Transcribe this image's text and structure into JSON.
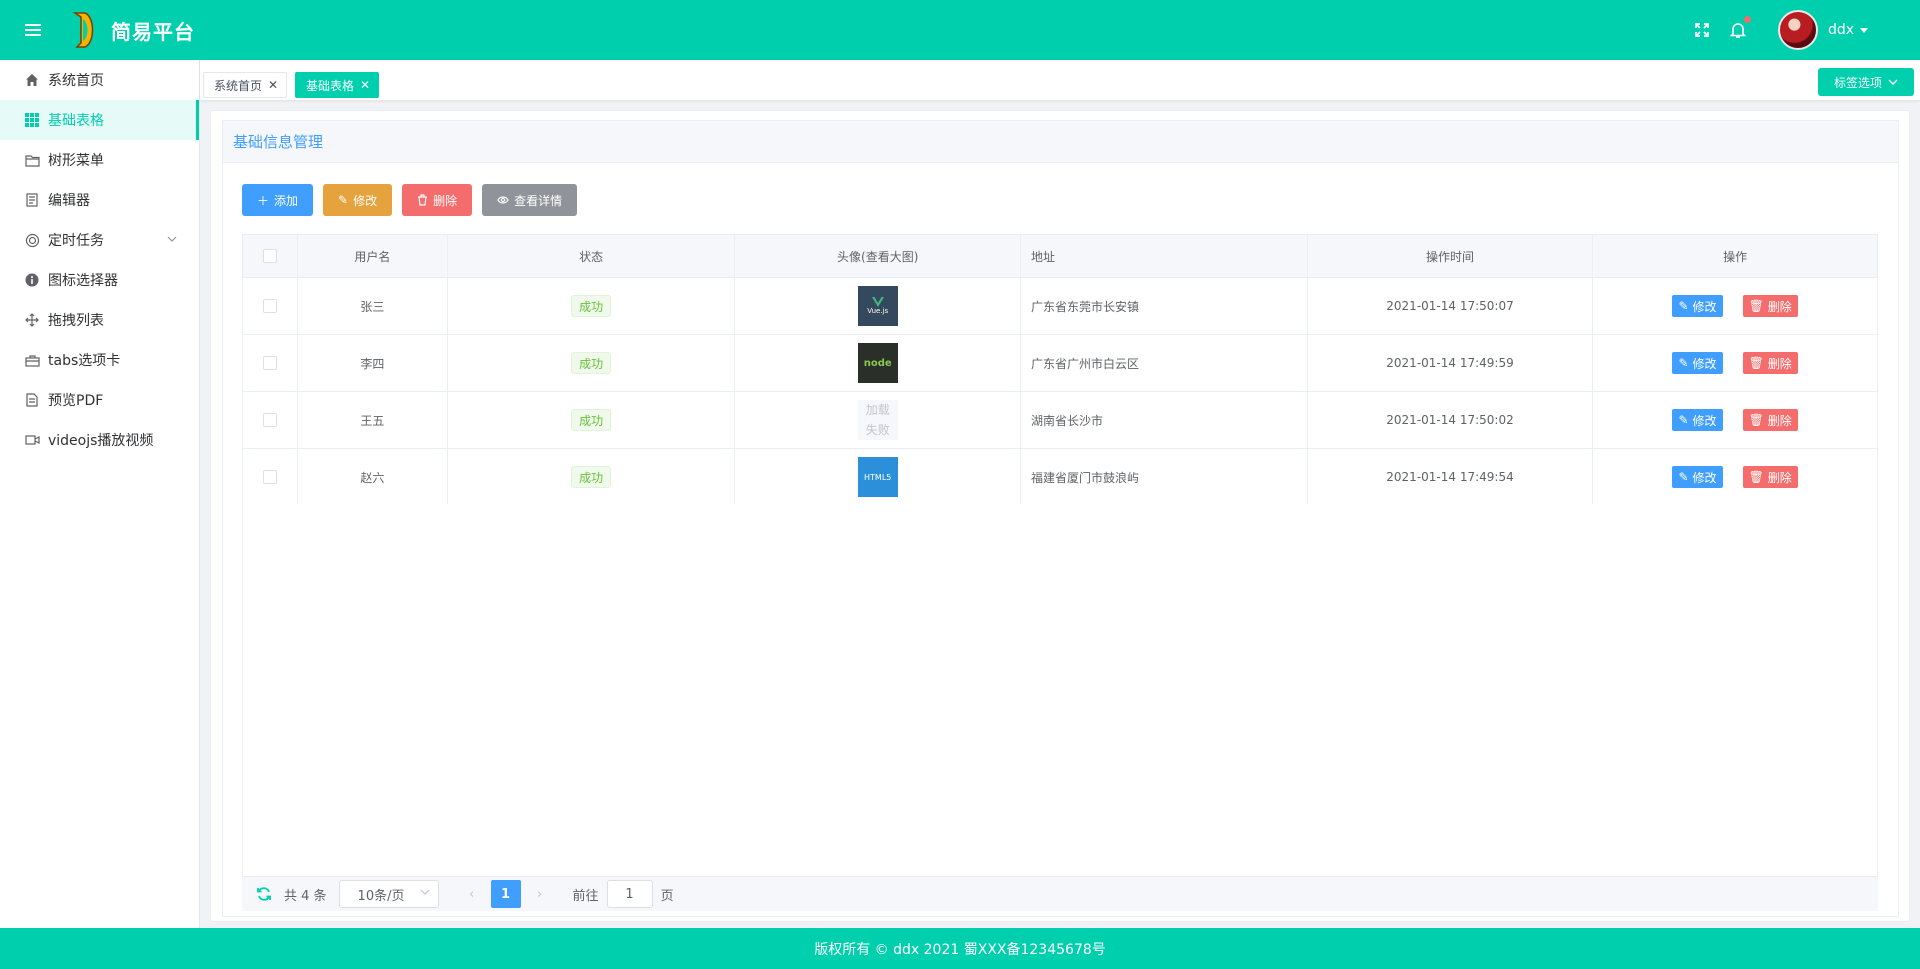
{
  "header": {
    "brand": "简易平台",
    "user": "ddx",
    "colors": {
      "primary": "#00cfae"
    }
  },
  "sidebar": {
    "items": [
      {
        "label": "系统首页",
        "icon": "home-icon"
      },
      {
        "label": "基础表格",
        "icon": "grid-icon",
        "active": true
      },
      {
        "label": "树形菜单",
        "icon": "folder-icon"
      },
      {
        "label": "编辑器",
        "icon": "document-icon"
      },
      {
        "label": "定时任务",
        "icon": "timer-icon",
        "has_submenu": true
      },
      {
        "label": "图标选择器",
        "icon": "info-icon"
      },
      {
        "label": "拖拽列表",
        "icon": "drag-icon"
      },
      {
        "label": "tabs选项卡",
        "icon": "briefcase-icon"
      },
      {
        "label": "预览PDF",
        "icon": "file-icon"
      },
      {
        "label": "videojs播放视频",
        "icon": "video-icon"
      }
    ]
  },
  "tabs": {
    "items": [
      {
        "label": "系统首页",
        "active": false
      },
      {
        "label": "基础表格",
        "active": true
      }
    ],
    "options_label": "标签选项"
  },
  "card": {
    "title": "基础信息管理"
  },
  "toolbar": {
    "add": "添加",
    "edit": "修改",
    "delete": "删除",
    "view": "查看详情"
  },
  "table": {
    "columns": [
      "用户名",
      "状态",
      "头像(查看大图)",
      "地址",
      "操作时间",
      "操作"
    ],
    "rows": [
      {
        "name": "张三",
        "status": "成功",
        "avatar": "vue",
        "avatar_text": "Vue.js",
        "address": "广东省东莞市长安镇",
        "time": "2021-01-14 17:50:07"
      },
      {
        "name": "李四",
        "status": "成功",
        "avatar": "node",
        "avatar_text": "node",
        "address": "广东省广州市白云区",
        "time": "2021-01-14 17:49:59"
      },
      {
        "name": "王五",
        "status": "成功",
        "avatar": "fail",
        "avatar_text": "加载失败",
        "address": "湖南省长沙市",
        "time": "2021-01-14 17:50:02"
      },
      {
        "name": "赵六",
        "status": "成功",
        "avatar": "html5",
        "avatar_text": "HTML5",
        "address": "福建省厦门市鼓浪屿",
        "time": "2021-01-14 17:49:54"
      }
    ],
    "op_edit": "修改",
    "op_delete": "删除"
  },
  "pagination": {
    "total": "共 4 条",
    "page_size": "10条/页",
    "current_page": "1",
    "goto_label": "前往",
    "goto_value": "1",
    "page_unit": "页"
  },
  "footer": {
    "text": "版权所有 © ddx 2021 蜀XXX备12345678号"
  }
}
